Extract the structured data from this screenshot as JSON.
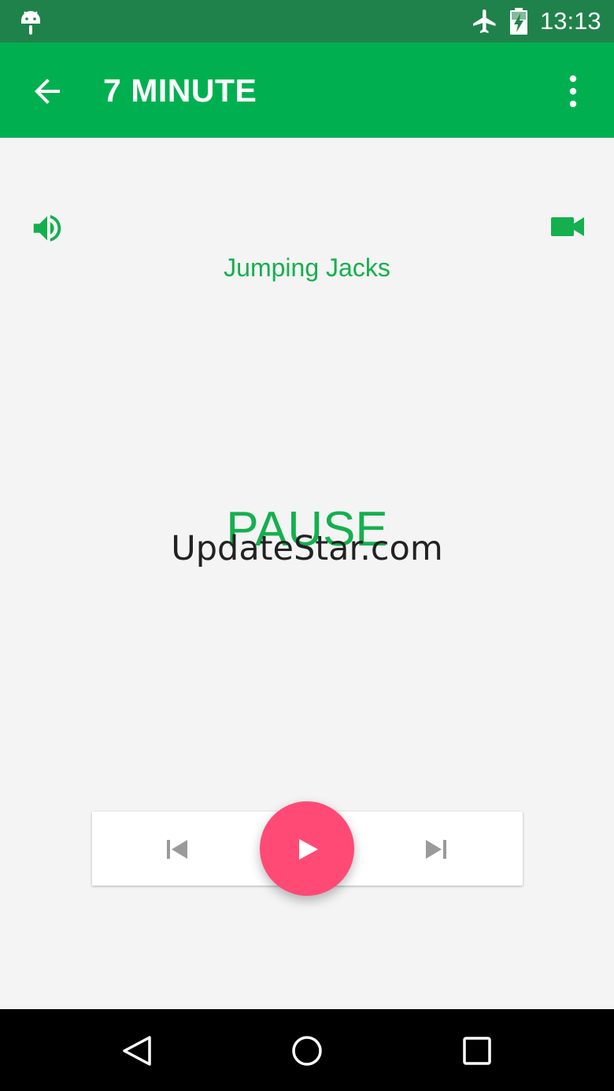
{
  "status_bar": {
    "time": "13:13",
    "icons": [
      "android-icon",
      "airplane-mode-icon",
      "battery-charging-icon"
    ]
  },
  "app_bar": {
    "title": "7 MINUTE",
    "back_icon": "arrow-left-icon",
    "menu_icon": "more-vert-icon"
  },
  "workout": {
    "sound_icon": "volume-up-icon",
    "video_icon": "videocam-icon",
    "exercise_name": "Jumping Jacks",
    "state_label": "PAUSE"
  },
  "watermark": "UpdateStar.com",
  "controls": {
    "previous_icon": "skip-previous-icon",
    "play_icon": "play-icon",
    "next_icon": "skip-next-icon"
  },
  "nav_bar": {
    "icons": [
      "nav-back-icon",
      "nav-home-icon",
      "nav-recents-icon"
    ]
  },
  "colors": {
    "status_bar": "#20824b",
    "app_bar": "#00b050",
    "accent_green": "#14b04e",
    "fab": "#ff4a75",
    "background": "#f4f4f4"
  }
}
